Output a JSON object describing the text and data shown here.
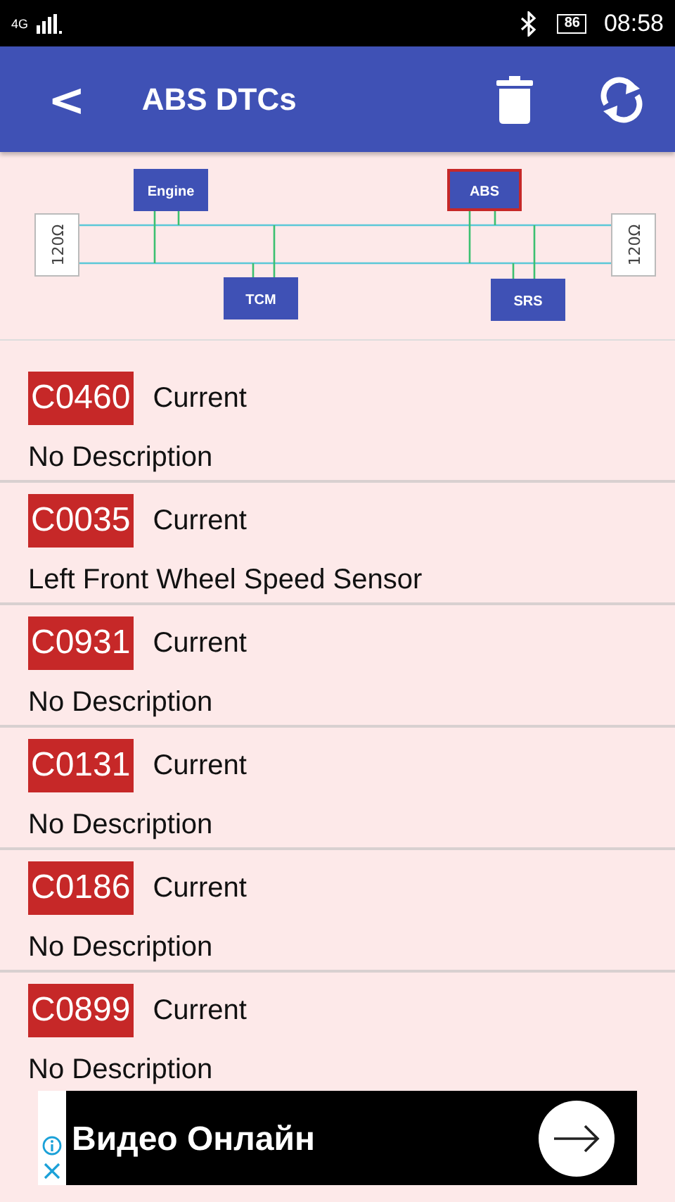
{
  "status_bar": {
    "network": "4G",
    "battery": "86",
    "time": "08:58"
  },
  "app_bar": {
    "back": "<",
    "title": "ABS DTCs"
  },
  "bus_diagram": {
    "terminators": [
      "120Ω",
      "120Ω"
    ],
    "modules": [
      {
        "label": "Engine",
        "selected": false
      },
      {
        "label": "ABS",
        "selected": true
      },
      {
        "label": "TCM",
        "selected": false
      },
      {
        "label": "SRS",
        "selected": false
      }
    ]
  },
  "dtcs": [
    {
      "code": "C0460",
      "status": "Current",
      "description": "No Description"
    },
    {
      "code": "C0035",
      "status": "Current",
      "description": "Left Front Wheel Speed Sensor"
    },
    {
      "code": "C0931",
      "status": "Current",
      "description": "No Description"
    },
    {
      "code": "C0131",
      "status": "Current",
      "description": "No Description"
    },
    {
      "code": "C0186",
      "status": "Current",
      "description": "No Description"
    },
    {
      "code": "C0899",
      "status": "Current",
      "description": "No Description"
    }
  ],
  "ad": {
    "text": "Видео Онлайн"
  }
}
